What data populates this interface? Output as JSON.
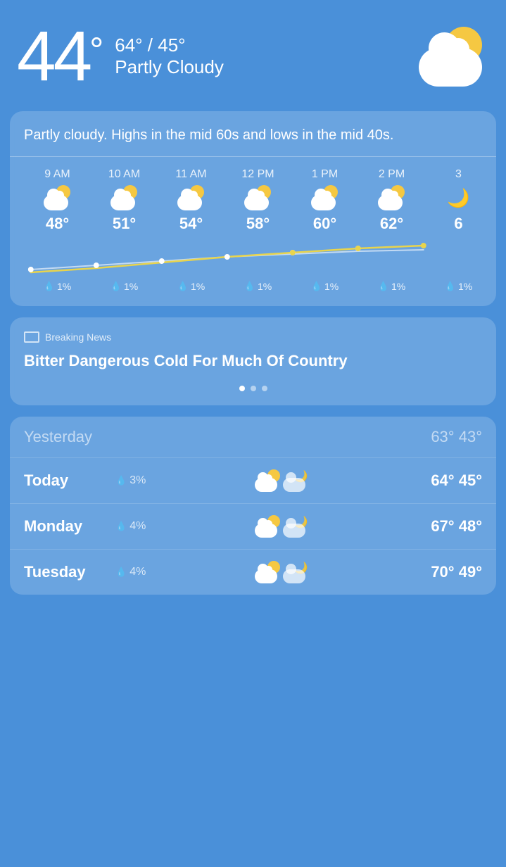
{
  "header": {
    "current_temp": "44",
    "degree_symbol": "°",
    "high": "64°",
    "low": "45°",
    "separator": "/",
    "condition": "Partly Cloudy"
  },
  "forecast_card": {
    "description": "Partly cloudy. Highs in the mid 60s and lows in the mid 40s.",
    "hourly": [
      {
        "time": "9 AM",
        "temp": "48°",
        "precip": "1%",
        "icon": "partly-cloudy"
      },
      {
        "time": "10 AM",
        "temp": "51°",
        "precip": "1%",
        "icon": "partly-cloudy"
      },
      {
        "time": "11 AM",
        "temp": "54°",
        "precip": "1%",
        "icon": "partly-cloudy"
      },
      {
        "time": "12 PM",
        "temp": "58°",
        "precip": "1%",
        "icon": "partly-cloudy"
      },
      {
        "time": "1 PM",
        "temp": "60°",
        "precip": "1%",
        "icon": "partly-cloudy"
      },
      {
        "time": "2 PM",
        "temp": "62°",
        "precip": "1%",
        "icon": "partly-cloudy"
      },
      {
        "time": "3",
        "temp": "6",
        "precip": "1%",
        "icon": "crescent"
      }
    ]
  },
  "news_card": {
    "label": "Breaking News",
    "headline": "Bitter Dangerous Cold For Much Of Country",
    "dots": [
      true,
      false,
      false
    ]
  },
  "daily_forecast": {
    "rows": [
      {
        "day": "Yesterday",
        "precip": "",
        "high": "63°",
        "low": "43°",
        "muted": true
      },
      {
        "day": "Today",
        "precip": "3%",
        "high": "64°",
        "low": "45°",
        "muted": false
      },
      {
        "day": "Monday",
        "precip": "4%",
        "high": "67°",
        "low": "48°",
        "muted": false
      },
      {
        "day": "Tuesday",
        "precip": "4%",
        "high": "70°",
        "low": "49°",
        "muted": false
      }
    ]
  }
}
